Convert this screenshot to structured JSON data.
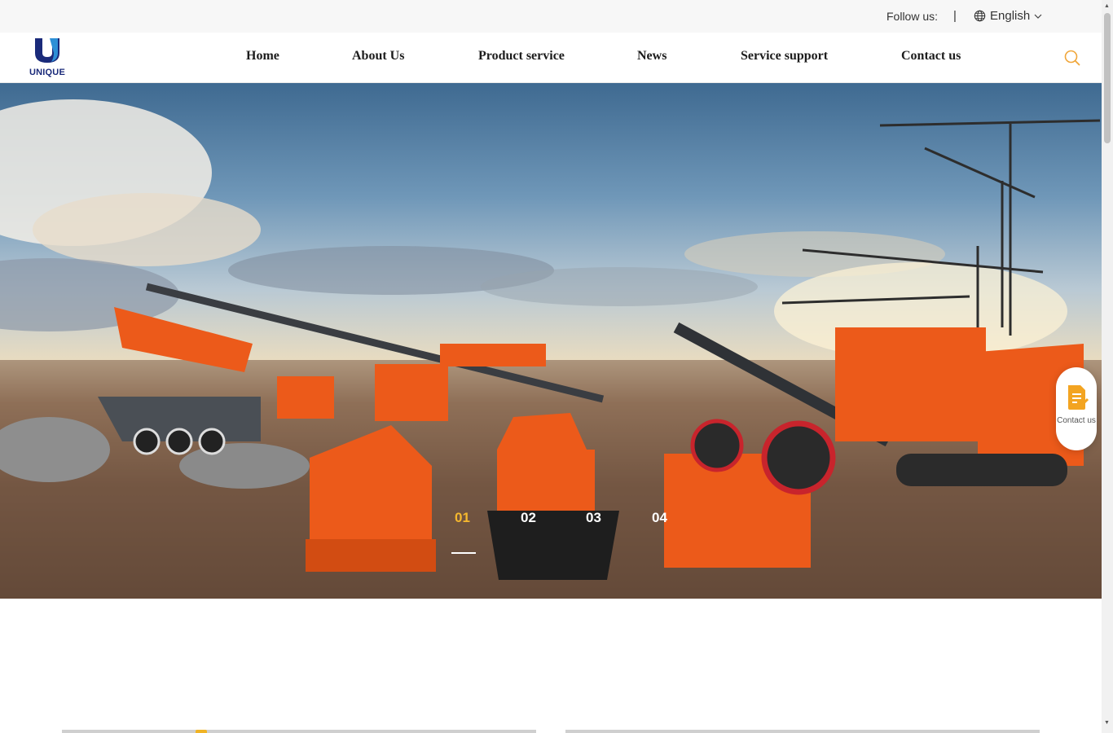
{
  "topbar": {
    "follow_label": "Follow us:",
    "separator": "|",
    "language": "English"
  },
  "logo": {
    "text": "UNIQUE",
    "color": "#1a2a7a"
  },
  "nav": {
    "items": [
      "Home",
      "About Us",
      "Product service",
      "News",
      "Service support",
      "Contact us"
    ]
  },
  "hero": {
    "slides": [
      "01",
      "02",
      "03",
      "04"
    ],
    "active_slide": "01",
    "active_color": "#f5b82e",
    "machine_color": "#ec5a1a"
  },
  "contact_float": {
    "label": "Contact us"
  },
  "icons": {
    "globe": "globe-icon",
    "chevron": "chevron-down-icon",
    "search": "search-icon",
    "contact": "document-edit-icon"
  }
}
